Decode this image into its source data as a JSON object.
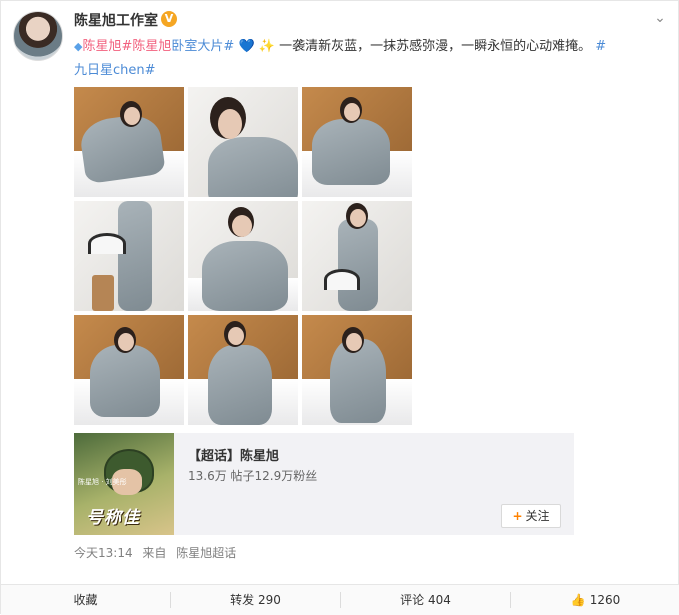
{
  "post": {
    "author": "陈星旭工作室",
    "verified_badge": "V",
    "text": {
      "diamond_icon": "◆",
      "tag1": "陈星旭",
      "tag2": "#陈星旭",
      "tag3": "卧室大片#",
      "heart": "💙",
      "star": "✨",
      "body": " 一袭清新灰蓝，一抹苏感弥漫，一瞬永恒的心动难掩。",
      "tag4": "#",
      "tag5": "九日星chen#"
    },
    "images_count": 9
  },
  "super_topic": {
    "title": "【超话】陈星旭",
    "stats": "13.6万 帖子12.9万粉丝",
    "cover_title": "号称佳",
    "cover_sub": "陈星旭 · 刘美彤",
    "follow_label": "关注",
    "follow_plus": "+"
  },
  "meta": {
    "time": "今天13:14",
    "source_prefix": "来自",
    "source": "陈星旭超话"
  },
  "actions": {
    "favorite": "收藏",
    "repost": "转发 290",
    "comment": "评论 404",
    "like_icon": "👍",
    "like_count": "1260"
  },
  "icons": {
    "chevron": "⌄"
  },
  "colors": {
    "tag_red": "#f2607e",
    "tag_blue": "#4c8bd6",
    "accent_orange": "#ff8200",
    "verified": "#f5a623"
  }
}
